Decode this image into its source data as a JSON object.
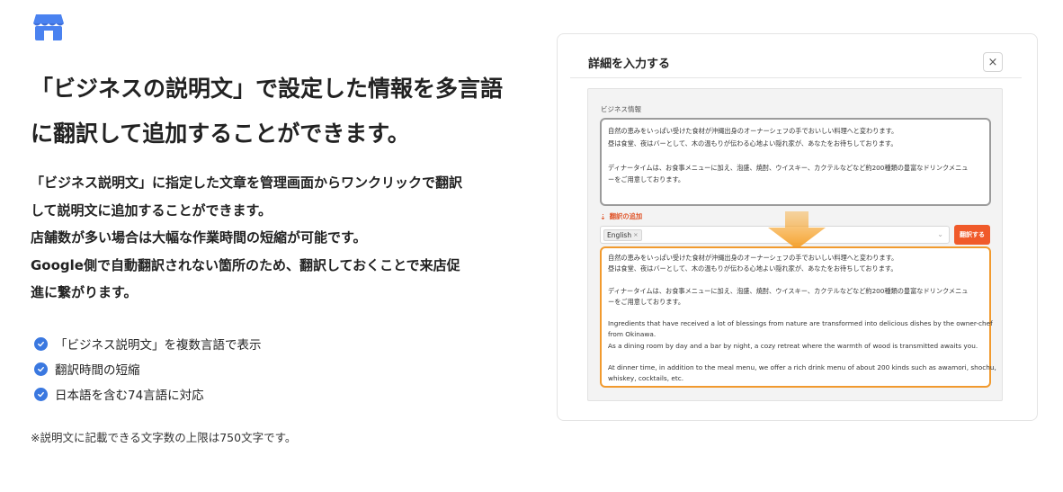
{
  "brand": {
    "logo_icon": "store-icon",
    "color": "#4a82f0"
  },
  "left": {
    "headline_lines": [
      "「ビジネスの説明文」で設定した情報を多言語",
      "に翻訳して追加することができます。"
    ],
    "description_lines": [
      "「ビジネス説明文」に指定した文章を管理画面からワンクリックで翻訳",
      "して説明文に追加することができます。",
      "店舗数が多い場合は大幅な作業時間の短縮が可能です。",
      "Google側で自動翻訳されない箇所のため、翻訳しておくことで来店促",
      "進に繋がります。"
    ],
    "features": [
      "「ビジネス説明文」を複数言語で表示",
      "翻訳時間の短縮",
      "日本語を含む74言語に対応"
    ],
    "footnote": "※説明文に記載できる文字数の上限は750文字です。"
  },
  "dialog": {
    "title": "詳細を入力する",
    "close_label": "×",
    "business_info_label": "ビジネス情報",
    "source_text": {
      "line1": "自然の恵みをいっぱい受けた食材が沖縄出身のオーナーシェフの手でおいしい料理へと変わります。",
      "line2": "昼は食堂、夜はバーとして、木の温もりが伝わる心地よい隠れ家が、あなたをお待ちしております。",
      "line3": "ディナータイムは、お食事メニューに加え、泡盛、焼酎、ウイスキー、カクテルなどなど約200種類の豊富なドリンクメニュ",
      "line4": "ーをご用意しております。"
    },
    "add_translation_label": "翻訳の追加",
    "selected_language": "English",
    "tag_remove": "×",
    "translate_button": "翻訳する",
    "output_text": {
      "ja1": "自然の恵みをいっぱい受けた食材が沖縄出身のオーナーシェフの手でおいしい料理へと変わります。",
      "ja2": "昼は食堂、夜はバーとして、木の温もりが伝わる心地よい隠れ家が、あなたをお待ちしております。",
      "ja3": "ディナータイムは、お食事メニューに加え、泡盛、焼酎、ウイスキー、カクテルなどなど約200種類の豊富なドリンクメニュ",
      "ja4": "ーをご用意しております。",
      "en1": "Ingredients that have received a lot of blessings from nature are transformed into delicious dishes by the owner-chef",
      "en2": "from Okinawa.",
      "en3": "As a dining room by day and a bar by night, a cozy retreat where the warmth of wood is transmitted awaits you.",
      "en4": "At dinner time, in addition to the meal menu, we offer a rich drink menu of about 200 kinds such as awamori, shochu,",
      "en5": "whiskey, cocktails, etc."
    },
    "colors": {
      "accent_orange": "#f05a2a",
      "output_border": "#f19a2e",
      "check_blue": "#3a78e0"
    }
  }
}
